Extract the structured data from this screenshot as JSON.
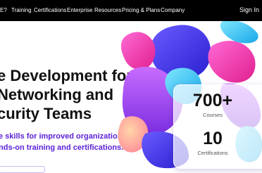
{
  "nav": {
    "items": [
      "E?",
      "Training",
      "Certifications",
      "Enterprise",
      "Resources",
      "Pricing & Plans",
      "Company"
    ],
    "sign_in": "Sign In"
  },
  "hero": {
    "title_lines": [
      "e Development for",
      "Networking and",
      "curity Teams"
    ],
    "subtitle_lines": [
      "e skills for improved organizational",
      "nds-on training and certifications."
    ]
  },
  "stats": [
    {
      "value": "700+",
      "label": "Courses"
    },
    {
      "value": "10",
      "label": "Certifications"
    }
  ],
  "colors": {
    "nav_bg": "#000000",
    "accent": "#5b21d6",
    "blob_blue": "#4a3cf0",
    "blob_pink": "#ff2fa6",
    "blob_cyan": "#22c8f0"
  }
}
